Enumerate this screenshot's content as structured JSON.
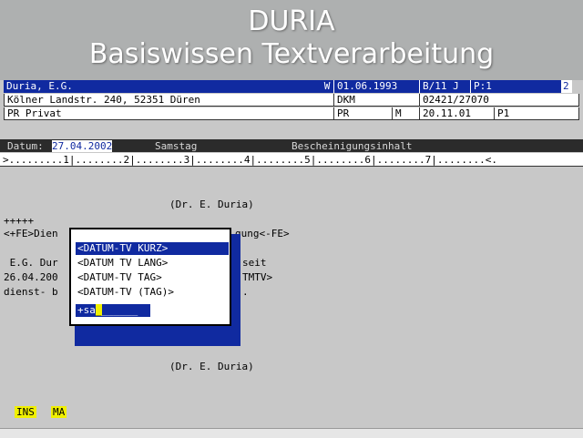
{
  "banner": {
    "title": "DURIA",
    "subtitle": "Basiswissen Textverarbeitung"
  },
  "header": {
    "row1": {
      "name": "Duria, E.G.",
      "flag": "W",
      "date": "01.06.1993",
      "code": "B/11 J",
      "page": "P:1",
      "num": "2"
    },
    "row2": {
      "address": "Kölner Landstr. 240, 52351 Düren",
      "type": "DKM",
      "phone": "02421/27070"
    },
    "row3": {
      "group": "PR Privat",
      "pr": "PR",
      "m": "M",
      "date2": "20.11.01",
      "p1": "P1"
    }
  },
  "datum_bar": {
    "label": "Datum:",
    "value": "27.04.2002",
    "day": "Samstag",
    "content": "Bescheinigungsinhalt"
  },
  "ruler": {
    "text": ">.........1|........2|........3|........4|........5|........6|........7|........<."
  },
  "document": {
    "line1": "(Dr. E. Duria)",
    "line2": "+++++",
    "line3a": "<+FE>Dien",
    "line3b": "gung<-FE>",
    "line4a": " E.G. Dur",
    "line4b": "seit",
    "line5a": "26.04.200",
    "line5b": "TMTV>",
    "line6a": "dienst- b",
    "line6b": ".",
    "line7": "(Dr. E. Duria)"
  },
  "popup": {
    "items": [
      "<DATUM-TV KURZ>",
      "<DATUM TV LANG>",
      "<DATUM-TV TAG>",
      "<DATUM-TV (TAG)>"
    ],
    "selected_index": 0,
    "input_prefix": "+sa",
    "input_placeholder": "______"
  },
  "status": {
    "ins": "INS",
    "ma": "MA"
  },
  "colors": {
    "blue": "#102aa0",
    "yellow": "#f0f000",
    "background": "#c8c8c8"
  }
}
